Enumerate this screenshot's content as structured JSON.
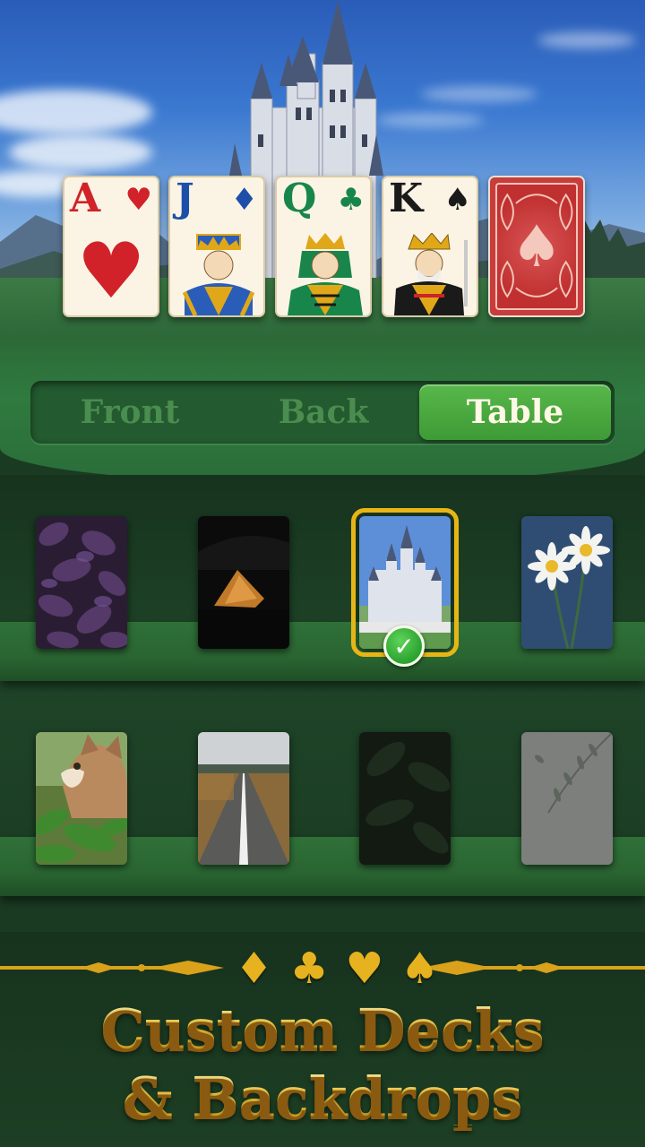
{
  "cards": [
    {
      "rank": "A",
      "suit": "♥",
      "color": "#d02228"
    },
    {
      "rank": "J",
      "suit": "♦",
      "color": "#1d4fa8"
    },
    {
      "rank": "Q",
      "suit": "♣",
      "color": "#18864a"
    },
    {
      "rank": "K",
      "suit": "♠",
      "color": "#1a1a1a"
    }
  ],
  "card_back": {
    "suit": "♠",
    "color": "#c93c3c"
  },
  "tabs": [
    {
      "label": "Front",
      "active": false
    },
    {
      "label": "Back",
      "active": false
    },
    {
      "label": "Table",
      "active": true
    }
  ],
  "backdrops": [
    {
      "name": "purple-leaves",
      "selected": false
    },
    {
      "name": "night-tent",
      "selected": false
    },
    {
      "name": "castle",
      "selected": true
    },
    {
      "name": "daisies",
      "selected": false
    },
    {
      "name": "kitten",
      "selected": false
    },
    {
      "name": "road",
      "selected": false
    },
    {
      "name": "dark-leaves",
      "selected": false
    },
    {
      "name": "grey-branch",
      "selected": false
    }
  ],
  "banner": {
    "suits": [
      "♦",
      "♣",
      "♥",
      "♠"
    ],
    "line1": "Custom Decks",
    "line2": "& Backdrops"
  },
  "colors": {
    "accent_gold": "#e6b21f",
    "tab_active": "#4aa83e",
    "felt": "#2c6a38"
  }
}
